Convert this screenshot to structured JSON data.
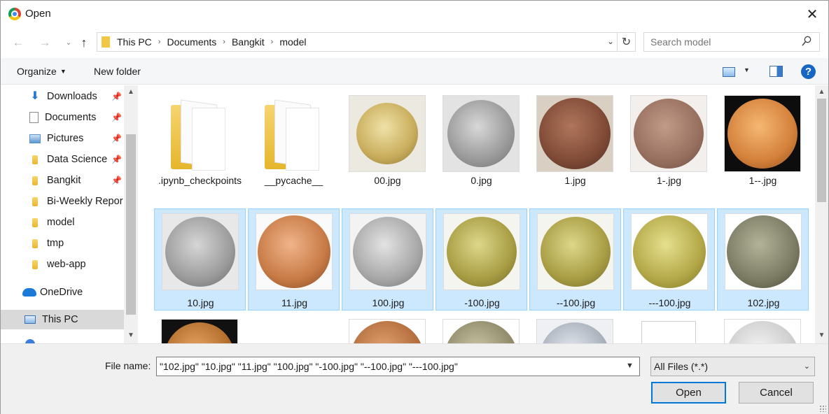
{
  "window": {
    "title": "Open",
    "close_glyph": "✕"
  },
  "nav": {
    "back": "←",
    "forward": "→",
    "recent": "⌄",
    "up": "↑"
  },
  "address": {
    "crumbs": [
      "This PC",
      "Documents",
      "Bangkit",
      "model"
    ],
    "separator": "›",
    "dropdown_glyph": "⌄",
    "refresh_glyph": "↻"
  },
  "search": {
    "placeholder": "Search model"
  },
  "toolbar": {
    "organize": "Organize",
    "new_folder": "New folder",
    "help": "?"
  },
  "sidebar": {
    "items": [
      {
        "label": "Downloads",
        "icon": "download-icon",
        "pinned": true
      },
      {
        "label": "Documents",
        "icon": "documents-icon",
        "pinned": true
      },
      {
        "label": "Pictures",
        "icon": "pictures-icon",
        "pinned": true
      },
      {
        "label": "Data Science",
        "icon": "folder-icon",
        "pinned": true
      },
      {
        "label": "Bangkit",
        "icon": "folder-icon",
        "pinned": true
      },
      {
        "label": "Bi-Weekly Repor",
        "icon": "folder-icon",
        "pinned": false
      },
      {
        "label": "model",
        "icon": "folder-icon",
        "pinned": false
      },
      {
        "label": "tmp",
        "icon": "folder-icon",
        "pinned": false
      },
      {
        "label": "web-app",
        "icon": "folder-icon",
        "pinned": false
      },
      {
        "label": "OneDrive",
        "icon": "onedrive-icon",
        "pinned": false
      },
      {
        "label": "This PC",
        "icon": "this-pc-icon",
        "pinned": false,
        "selected": true
      }
    ],
    "pin_glyph": "📌"
  },
  "files": {
    "row1": [
      {
        "name": ".ipynb_checkpoints",
        "kind": "folder"
      },
      {
        "name": "__pycache__",
        "kind": "folder"
      },
      {
        "name": "00.jpg",
        "kind": "image"
      },
      {
        "name": "0.jpg",
        "kind": "image"
      },
      {
        "name": "1.jpg",
        "kind": "image"
      },
      {
        "name": "1-.jpg",
        "kind": "image"
      },
      {
        "name": "1--.jpg",
        "kind": "image"
      }
    ],
    "row2": [
      {
        "name": "10.jpg",
        "kind": "image",
        "selected": true
      },
      {
        "name": "11.jpg",
        "kind": "image",
        "selected": true
      },
      {
        "name": "100.jpg",
        "kind": "image",
        "selected": true
      },
      {
        "name": "-100.jpg",
        "kind": "image",
        "selected": true
      },
      {
        "name": "--100.jpg",
        "kind": "image",
        "selected": true
      },
      {
        "name": "---100.jpg",
        "kind": "image",
        "selected": true
      },
      {
        "name": "102.jpg",
        "kind": "image",
        "selected": true
      }
    ]
  },
  "footer": {
    "file_name_label": "File name:",
    "file_name_value": "\"102.jpg\" \"10.jpg\" \"11.jpg\" \"100.jpg\" \"-100.jpg\" \"--100.jpg\" \"---100.jpg\"",
    "file_type": "All Files (*.*)",
    "open": "Open",
    "cancel": "Cancel"
  },
  "colors": {
    "selection_bg": "#cce8ff",
    "selection_border": "#99d1ff",
    "accent": "#0078d7"
  }
}
